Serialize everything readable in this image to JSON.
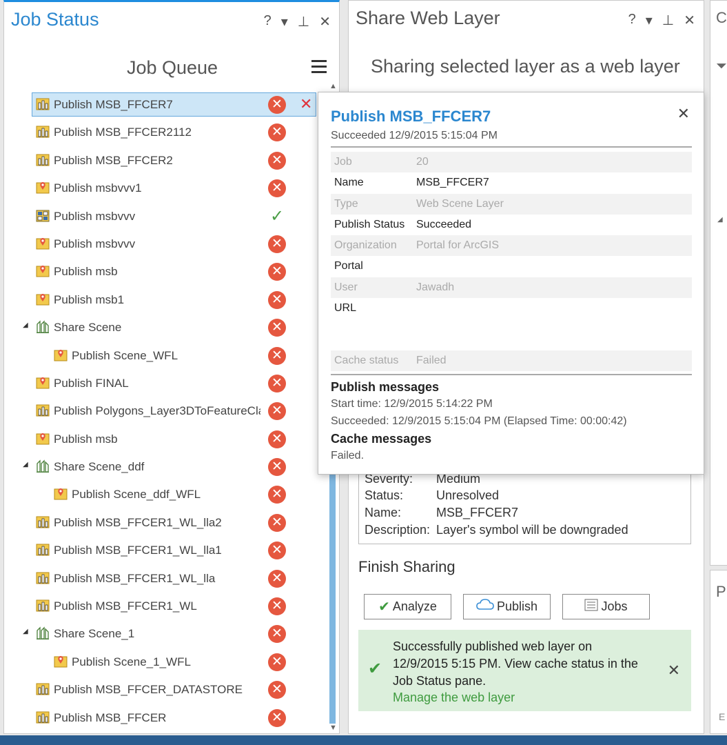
{
  "job_status": {
    "title": "Job Status",
    "help": "?",
    "menu": "▾",
    "pin": "⊥",
    "close": "✕",
    "queue_title": "Job Queue",
    "items": [
      {
        "label": "Publish MSB_FFCER7",
        "status": "failed",
        "icon": "tile-layer-icon",
        "indent": 0,
        "selected": true,
        "expander": ""
      },
      {
        "label": "Publish MSB_FFCER2112",
        "status": "failed",
        "icon": "tile-layer-icon",
        "indent": 0,
        "expander": ""
      },
      {
        "label": "Publish MSB_FFCER2",
        "status": "failed",
        "icon": "tile-layer-icon",
        "indent": 0,
        "expander": ""
      },
      {
        "label": "Publish msbvvv1",
        "status": "failed",
        "icon": "map-pin-icon",
        "indent": 0,
        "expander": ""
      },
      {
        "label": "Publish msbvvv",
        "status": "succeeded",
        "icon": "grid-layer-icon",
        "indent": 0,
        "expander": ""
      },
      {
        "label": "Publish msbvvv",
        "status": "failed",
        "icon": "map-pin-icon",
        "indent": 0,
        "expander": ""
      },
      {
        "label": "Publish msb",
        "status": "failed",
        "icon": "map-pin-icon",
        "indent": 0,
        "expander": ""
      },
      {
        "label": "Publish msb1",
        "status": "failed",
        "icon": "map-pin-icon",
        "indent": 0,
        "expander": ""
      },
      {
        "label": "Share Scene",
        "status": "failed",
        "icon": "scene-icon",
        "indent": 0,
        "expander": "◢"
      },
      {
        "label": "Publish Scene_WFL",
        "status": "failed",
        "icon": "map-pin-icon",
        "indent": 1,
        "expander": ""
      },
      {
        "label": "Publish FINAL",
        "status": "failed",
        "icon": "map-pin-icon",
        "indent": 0,
        "expander": ""
      },
      {
        "label": "Publish Polygons_Layer3DToFeatureCla",
        "status": "failed",
        "icon": "tile-layer-icon",
        "indent": 0,
        "expander": ""
      },
      {
        "label": "Publish msb",
        "status": "failed",
        "icon": "map-pin-icon",
        "indent": 0,
        "expander": ""
      },
      {
        "label": "Share Scene_ddf",
        "status": "failed",
        "icon": "scene-icon",
        "indent": 0,
        "expander": "◢"
      },
      {
        "label": "Publish Scene_ddf_WFL",
        "status": "failed",
        "icon": "map-pin-icon",
        "indent": 1,
        "expander": ""
      },
      {
        "label": "Publish MSB_FFCER1_WL_lla2",
        "status": "failed",
        "icon": "tile-layer-icon",
        "indent": 0,
        "expander": ""
      },
      {
        "label": "Publish MSB_FFCER1_WL_lla1",
        "status": "failed",
        "icon": "tile-layer-icon",
        "indent": 0,
        "expander": ""
      },
      {
        "label": "Publish MSB_FFCER1_WL_lla",
        "status": "failed",
        "icon": "tile-layer-icon",
        "indent": 0,
        "expander": ""
      },
      {
        "label": "Publish MSB_FFCER1_WL",
        "status": "failed",
        "icon": "tile-layer-icon",
        "indent": 0,
        "expander": ""
      },
      {
        "label": "Share Scene_1",
        "status": "failed",
        "icon": "scene-icon",
        "indent": 0,
        "expander": "◢"
      },
      {
        "label": "Publish Scene_1_WFL",
        "status": "failed",
        "icon": "map-pin-icon",
        "indent": 1,
        "expander": ""
      },
      {
        "label": "Publish MSB_FFCER_DATASTORE",
        "status": "failed",
        "icon": "tile-layer-icon",
        "indent": 0,
        "expander": ""
      },
      {
        "label": "Publish MSB_FFCER",
        "status": "failed",
        "icon": "tile-layer-icon",
        "indent": 0,
        "expander": ""
      }
    ]
  },
  "share": {
    "title": "Share Web Layer",
    "help": "?",
    "menu": "▾",
    "pin": "⊥",
    "close": "✕",
    "subtitle": "Sharing selected layer as a web layer",
    "error_box": {
      "severity_k": "Severity:",
      "severity_v": "Medium",
      "status_k": "Status:",
      "status_v": "Unresolved",
      "name_k": "Name:",
      "name_v": "MSB_FFCER7",
      "desc_k": "Description:",
      "desc_v": "Layer's symbol will be downgraded"
    },
    "finish_title": "Finish Sharing",
    "buttons": {
      "analyze": "Analyze",
      "publish": "Publish",
      "jobs": "Jobs"
    },
    "success": {
      "line1": "Successfully published web layer on",
      "line2": "12/9/2015 5:15 PM. View cache status in the",
      "line3": "Job Status pane.",
      "link": "Manage the web layer",
      "close": "✕"
    }
  },
  "popup": {
    "title": "Publish MSB_FFCER7",
    "close": "✕",
    "subtitle": "Succeeded 12/9/2015 5:15:04 PM",
    "rows": [
      {
        "k": "Job",
        "v": "20"
      },
      {
        "k": "Name",
        "v": "MSB_FFCER7"
      },
      {
        "k": "Type",
        "v": "Web Scene Layer"
      },
      {
        "k": "Publish Status",
        "v": "Succeeded"
      },
      {
        "k": "Organization",
        "v": "Portal for ArcGIS"
      },
      {
        "k": "Portal",
        "v": ""
      },
      {
        "k": "User",
        "v": "Jawadh"
      },
      {
        "k": "URL",
        "v": ""
      }
    ],
    "cache_k": "Cache status",
    "cache_v": "Failed",
    "publish_messages_title": "Publish messages",
    "start_time": "Start time: 12/9/2015 5:14:22 PM",
    "succeeded": "Succeeded: 12/9/2015 5:15:04 PM (Elapsed Time:  00:00:42)",
    "cache_messages_title": "Cache messages",
    "cache_msg": "Failed."
  },
  "right": {
    "top_letter": "C",
    "bottom_letter": "P",
    "bottom_small": "E"
  },
  "colors": {
    "accent": "#2b87cf",
    "error": "#e5573f",
    "success": "#4a9e46"
  }
}
